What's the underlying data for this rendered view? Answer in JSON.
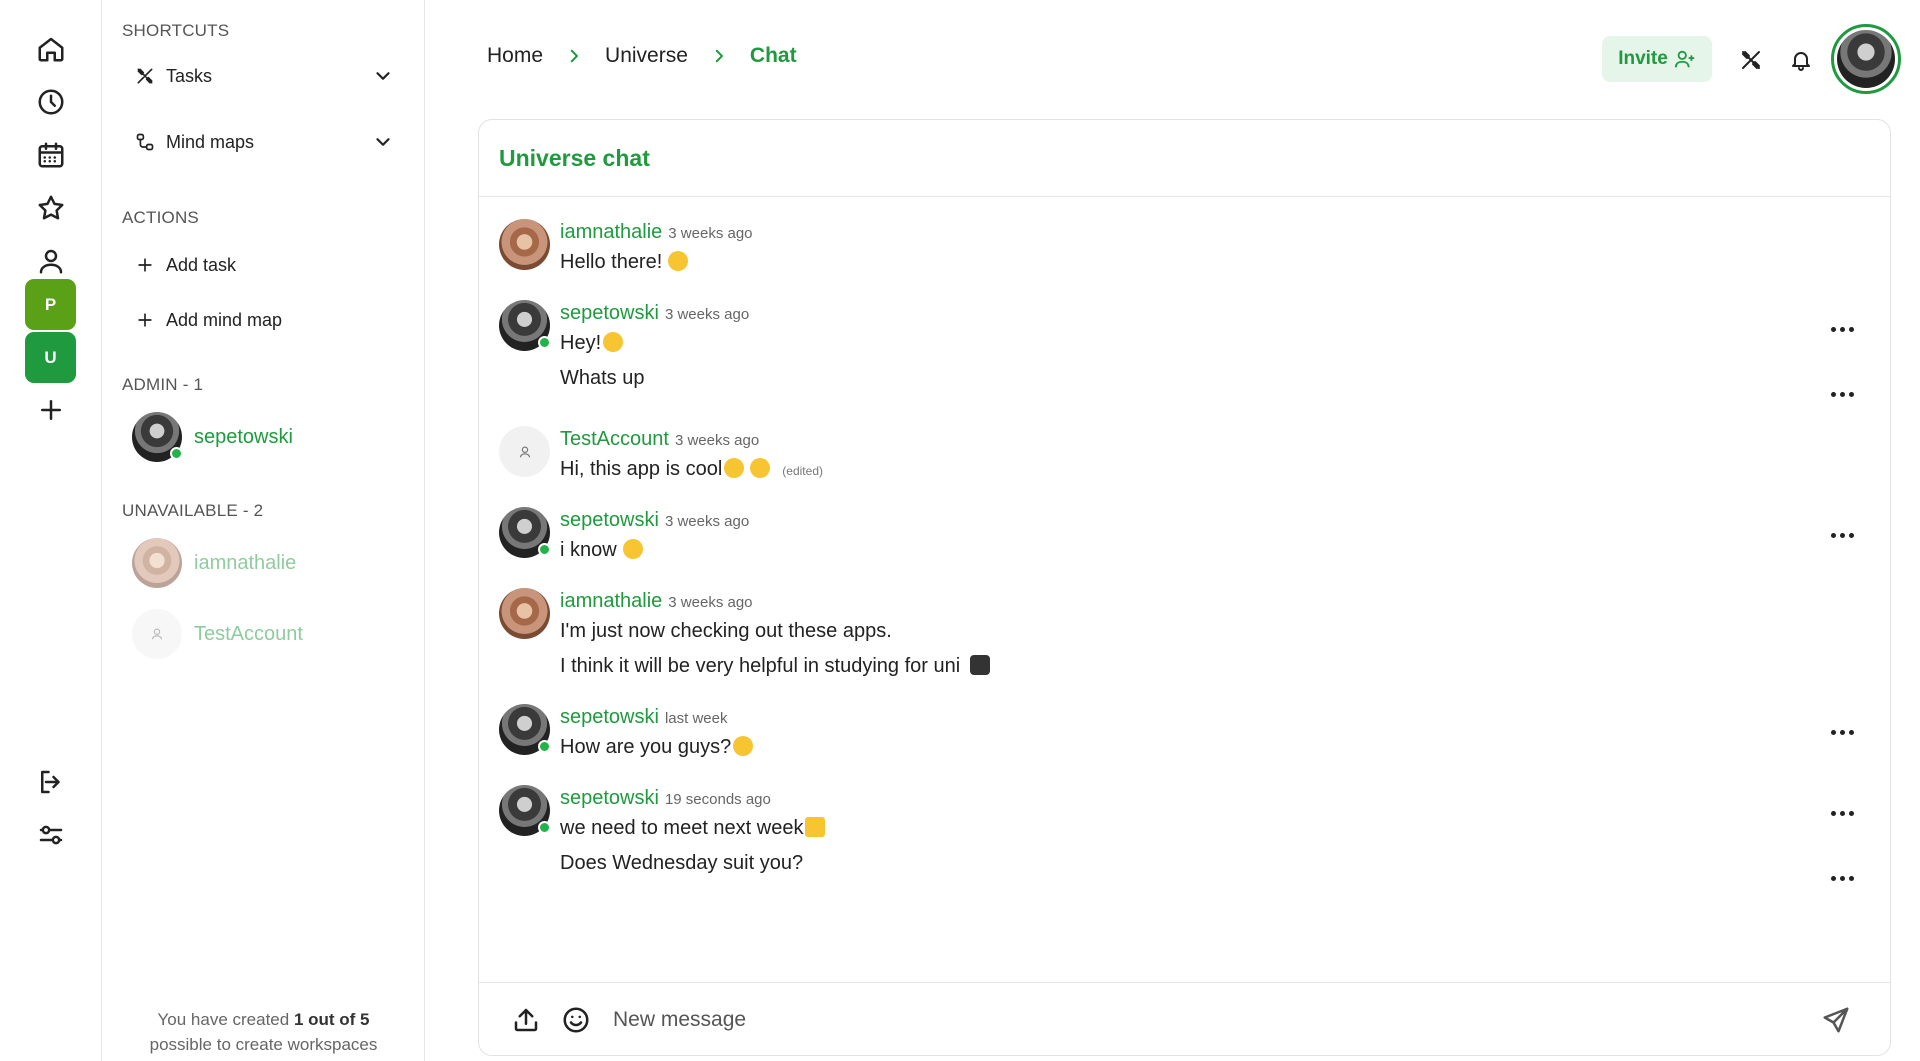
{
  "rail": {
    "workspaces": [
      {
        "letter": "P",
        "color": "#5aa117"
      },
      {
        "letter": "U",
        "color": "#1f9a3e"
      }
    ]
  },
  "sidebar": {
    "shortcuts_title": "SHORTCUTS",
    "shortcuts": [
      {
        "label": "Tasks",
        "icon": "tools-icon"
      },
      {
        "label": "Mind maps",
        "icon": "mind-map-icon"
      }
    ],
    "actions_title": "ACTIONS",
    "actions": [
      {
        "label": "Add task"
      },
      {
        "label": "Add mind map"
      }
    ],
    "admin_title": "ADMIN - 1",
    "admins": [
      {
        "name": "sepetowski",
        "online": true
      }
    ],
    "unavailable_title": "UNAVAILABLE - 2",
    "unavailable": [
      {
        "name": "iamnathalie"
      },
      {
        "name": "TestAccount"
      }
    ],
    "footer": {
      "prefix": "You have created ",
      "bold": "1 out of 5",
      "suffix": "possible to create workspaces"
    }
  },
  "header": {
    "breadcrumbs": [
      "Home",
      "Universe",
      "Chat"
    ],
    "invite_label": "Invite",
    "accent": "#1f9a3e"
  },
  "chat": {
    "title": "Universe chat",
    "messages": [
      {
        "author": "iamnathalie",
        "time": "3 weeks ago",
        "lines": [
          "Hello there!"
        ]
      },
      {
        "author": "sepetowski",
        "time": "3 weeks ago",
        "lines": [
          "Hey!",
          "Whats up"
        ]
      },
      {
        "author": "TestAccount",
        "time": "3 weeks ago",
        "lines": [
          "Hi, this app is cool"
        ],
        "edited": "(edited)"
      },
      {
        "author": "sepetowski",
        "time": "3 weeks ago",
        "lines": [
          "i know"
        ]
      },
      {
        "author": "iamnathalie",
        "time": "3 weeks ago",
        "lines": [
          "I'm just now checking out these apps.",
          "I think it will be very helpful in studying for uni"
        ]
      },
      {
        "author": "sepetowski",
        "time": "last week",
        "lines": [
          "How are you guys?"
        ]
      },
      {
        "author": "sepetowski",
        "time": "19 seconds ago",
        "lines": [
          "we need to meet next week",
          "Does Wednesday suit you?"
        ]
      }
    ],
    "input_placeholder": "New message"
  }
}
